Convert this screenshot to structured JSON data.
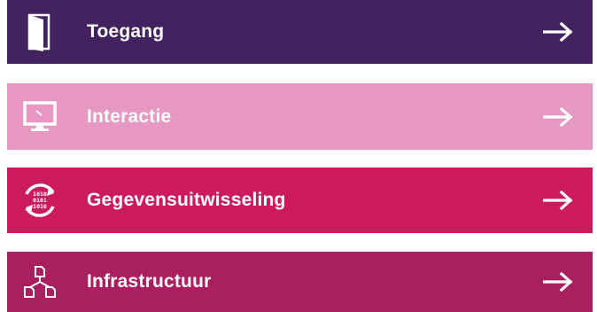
{
  "nav": {
    "items": [
      {
        "label": "Toegang",
        "icon": "door-icon",
        "color": "#42225f"
      },
      {
        "label": "Interactie",
        "icon": "monitor-icon",
        "color": "#e697c2"
      },
      {
        "label": "Gegevensuitwisseling",
        "icon": "data-exchange-icon",
        "color": "#cc1b5d",
        "icon_text": [
          "1010",
          "0101",
          "1010"
        ]
      },
      {
        "label": "Infrastructuur",
        "icon": "network-nodes-icon",
        "color": "#aa1f60"
      }
    ],
    "arrow_icon": "arrow-right-icon"
  }
}
